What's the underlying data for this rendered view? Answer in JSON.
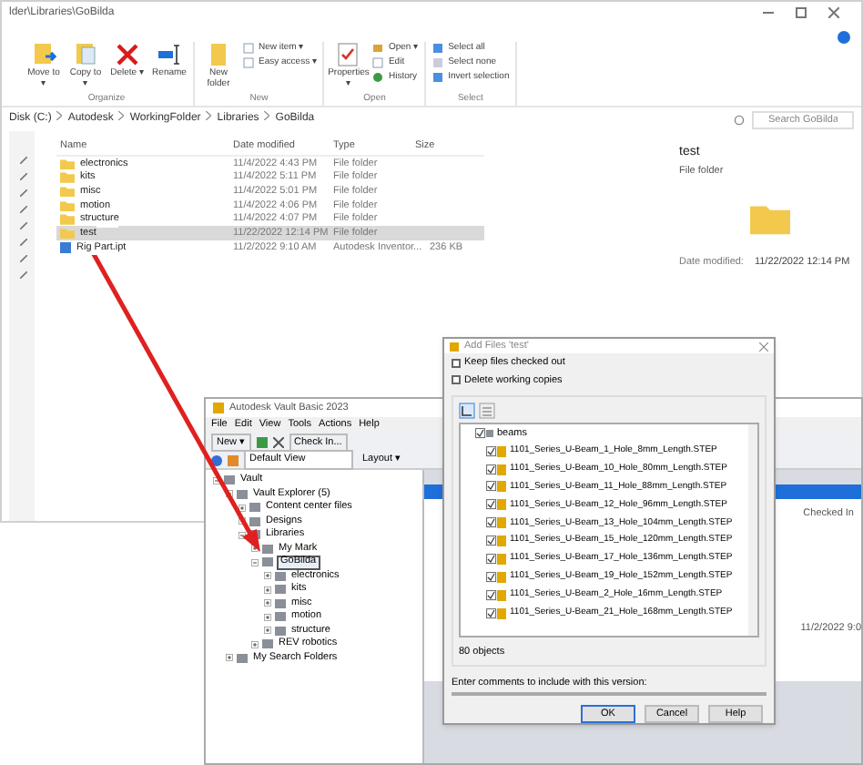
{
  "explorer": {
    "title": "lder\\Libraries\\GoBilda",
    "ribbon": [
      {
        "group": "Organize",
        "items": [
          {
            "kind": "big",
            "label": "Move to ▾"
          },
          {
            "kind": "big",
            "label": "Copy to ▾"
          },
          {
            "kind": "big",
            "label": "Delete ▾"
          },
          {
            "kind": "big",
            "label": "Rename"
          }
        ]
      },
      {
        "group": "New",
        "items": [
          {
            "kind": "big",
            "label": "New folder"
          },
          {
            "kind": "small",
            "label": "New item ▾"
          },
          {
            "kind": "small",
            "label": "Easy access ▾"
          }
        ]
      },
      {
        "group": "Open",
        "items": [
          {
            "kind": "big",
            "label": "Properties ▾"
          },
          {
            "kind": "small",
            "label": "Open ▾"
          },
          {
            "kind": "small",
            "label": "Edit"
          },
          {
            "kind": "small",
            "label": "History"
          }
        ]
      },
      {
        "group": "Select",
        "items": [
          {
            "kind": "small",
            "label": "Select all"
          },
          {
            "kind": "small",
            "label": "Select none"
          },
          {
            "kind": "small",
            "label": "Invert selection"
          }
        ]
      }
    ],
    "path": [
      "Disk (C:)",
      "Autodesk",
      "WorkingFolder",
      "Libraries",
      "GoBilda"
    ],
    "search": {
      "placeholder": "Search GoBilda"
    },
    "columns": [
      "Name",
      "Date modified",
      "Type",
      "Size"
    ],
    "rows": [
      {
        "kind": "folder",
        "name": "electronics",
        "date": "11/4/2022 4:43 PM",
        "type": "File folder",
        "selected": false
      },
      {
        "kind": "folder",
        "name": "kits",
        "date": "11/4/2022 5:11 PM",
        "type": "File folder",
        "selected": false
      },
      {
        "kind": "folder",
        "name": "misc",
        "date": "11/4/2022 5:01 PM",
        "type": "File folder",
        "selected": false
      },
      {
        "kind": "folder",
        "name": "motion",
        "date": "11/4/2022 4:06 PM",
        "type": "File folder",
        "selected": false
      },
      {
        "kind": "folder",
        "name": "structure",
        "date": "11/4/2022 4:07 PM",
        "type": "File folder",
        "selected": false
      },
      {
        "kind": "folder",
        "name": "test",
        "date": "11/22/2022 12:14 PM",
        "type": "File folder",
        "selected": true
      },
      {
        "kind": "file",
        "name": "Rig Part.ipt",
        "date": "11/2/2022 9:10 AM",
        "type": "Autodesk Inventor...",
        "size": "236 KB",
        "selected": false
      }
    ],
    "preview": {
      "name": "test",
      "type": "File folder",
      "date_label": "Date modified:",
      "date": "11/22/2022 12:14 PM"
    }
  },
  "vault": {
    "title": "Autodesk Vault Basic 2023",
    "menu": [
      "File",
      "Edit",
      "View",
      "Tools",
      "Actions",
      "Help"
    ],
    "toolbar": {
      "new": "New ▾",
      "checkin": "Check In...",
      "view": "Default View",
      "layout": "Layout ▾"
    },
    "tree": [
      {
        "label": "Vault",
        "expanded": true,
        "children": [
          {
            "label": "Vault Explorer (5)",
            "expanded": true,
            "children": [
              {
                "label": "Content center files",
                "expanded": false
              },
              {
                "label": "Designs",
                "expanded": false
              },
              {
                "label": "Libraries",
                "expanded": true,
                "children": [
                  {
                    "label": "My Mark",
                    "expanded": false
                  },
                  {
                    "label": "GoBilda",
                    "expanded": true,
                    "selected": true,
                    "children": [
                      {
                        "label": "electronics",
                        "expanded": false
                      },
                      {
                        "label": "kits",
                        "expanded": false
                      },
                      {
                        "label": "misc",
                        "expanded": false
                      },
                      {
                        "label": "motion",
                        "expanded": false
                      },
                      {
                        "label": "structure",
                        "expanded": false
                      }
                    ]
                  },
                  {
                    "label": "REV robotics",
                    "expanded": false
                  }
                ]
              }
            ]
          },
          {
            "label": "My Search Folders",
            "expanded": false
          }
        ]
      }
    ],
    "column": "Checked In",
    "cell": "11/2/2022 9:0"
  },
  "dialog": {
    "title": "Add Files 'test'",
    "options": [
      {
        "label": "Keep files checked out",
        "checked": false
      },
      {
        "label": "Delete working copies",
        "checked": false
      }
    ],
    "folder": "beams",
    "files": [
      "1101_Series_U-Beam_1_Hole_8mm_Length.STEP",
      "1101_Series_U-Beam_10_Hole_80mm_Length.STEP",
      "1101_Series_U-Beam_11_Hole_88mm_Length.STEP",
      "1101_Series_U-Beam_12_Hole_96mm_Length.STEP",
      "1101_Series_U-Beam_13_Hole_104mm_Length.STEP",
      "1101_Series_U-Beam_15_Hole_120mm_Length.STEP",
      "1101_Series_U-Beam_17_Hole_136mm_Length.STEP",
      "1101_Series_U-Beam_19_Hole_152mm_Length.STEP",
      "1101_Series_U-Beam_2_Hole_16mm_Length.STEP",
      "1101_Series_U-Beam_21_Hole_168mm_Length.STEP"
    ],
    "count": "80 objects",
    "comment_label": "Enter comments to include with this version:",
    "buttons": [
      "OK",
      "Cancel",
      "Help"
    ]
  }
}
